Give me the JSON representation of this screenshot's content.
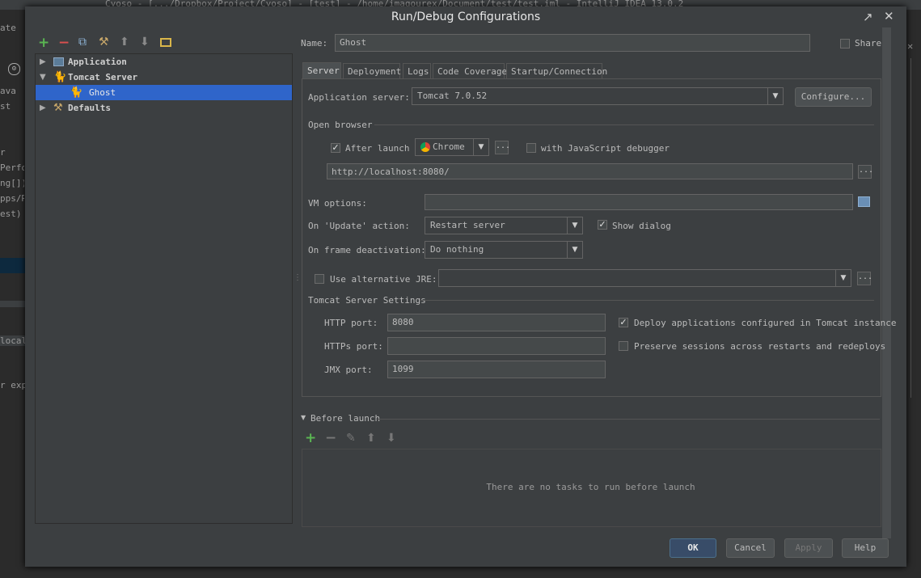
{
  "background": {
    "title_text": "Cyoso - [.../Dropbox/Project/Cyoso] - [test] - /home/imaqourex/Document/test/test.iml - IntelliJ IDEA 13.0.2",
    "left_fragments": [
      "ate",
      "ava",
      "st",
      "r",
      "Perfo",
      "ng[])",
      "pps/R",
      "est)",
      "localh",
      "r expl"
    ]
  },
  "dialog": {
    "title": "Run/Debug Configurations",
    "tree": {
      "items": [
        {
          "label": "Application",
          "level": 0,
          "expanded": false
        },
        {
          "label": "Tomcat Server",
          "level": 0,
          "expanded": true
        },
        {
          "label": "Ghost",
          "level": 1,
          "selected": true
        },
        {
          "label": "Defaults",
          "level": 0,
          "expanded": false
        }
      ]
    },
    "name_label": "Name:",
    "name_value": "Ghost",
    "share_label": "Share",
    "tabs": [
      "Server",
      "Deployment",
      "Logs",
      "Code Coverage",
      "Startup/Connection"
    ],
    "active_tab": "Server",
    "server": {
      "app_server_label": "Application server:",
      "app_server_value": "Tomcat 7.0.52",
      "configure_label": "Configure...",
      "open_browser_label": "Open browser",
      "after_launch_label": "After launch",
      "after_launch_checked": true,
      "browser_value": "Chrome",
      "ellipsis": "...",
      "js_debugger_label": "with JavaScript debugger",
      "js_debugger_checked": false,
      "url_value": "http://localhost:8080/",
      "vm_options_label": "VM options:",
      "vm_options_value": "",
      "on_update_label": "On 'Update' action:",
      "on_update_value": "Restart server",
      "show_dialog_label": "Show dialog",
      "show_dialog_checked": true,
      "frame_deactivation_label": "On frame deactivation:",
      "frame_deactivation_value": "Do nothing",
      "alt_jre_label": "Use alternative JRE:",
      "alt_jre_checked": false,
      "alt_jre_value": "",
      "tomcat_settings_label": "Tomcat Server Settings",
      "http_port_label": "HTTP port:",
      "http_port_value": "8080",
      "https_port_label": "HTTPs port:",
      "https_port_value": "",
      "jmx_port_label": "JMX port:",
      "jmx_port_value": "1099",
      "deploy_apps_label": "Deploy applications configured in Tomcat instance",
      "deploy_apps_checked": true,
      "preserve_sessions_label": "Preserve sessions across restarts and redeploys",
      "preserve_sessions_checked": false
    },
    "before_launch": {
      "label": "Before launch",
      "empty_text": "There are no tasks to run before launch"
    },
    "buttons": {
      "ok": "OK",
      "cancel": "Cancel",
      "apply": "Apply",
      "help": "Help"
    }
  }
}
